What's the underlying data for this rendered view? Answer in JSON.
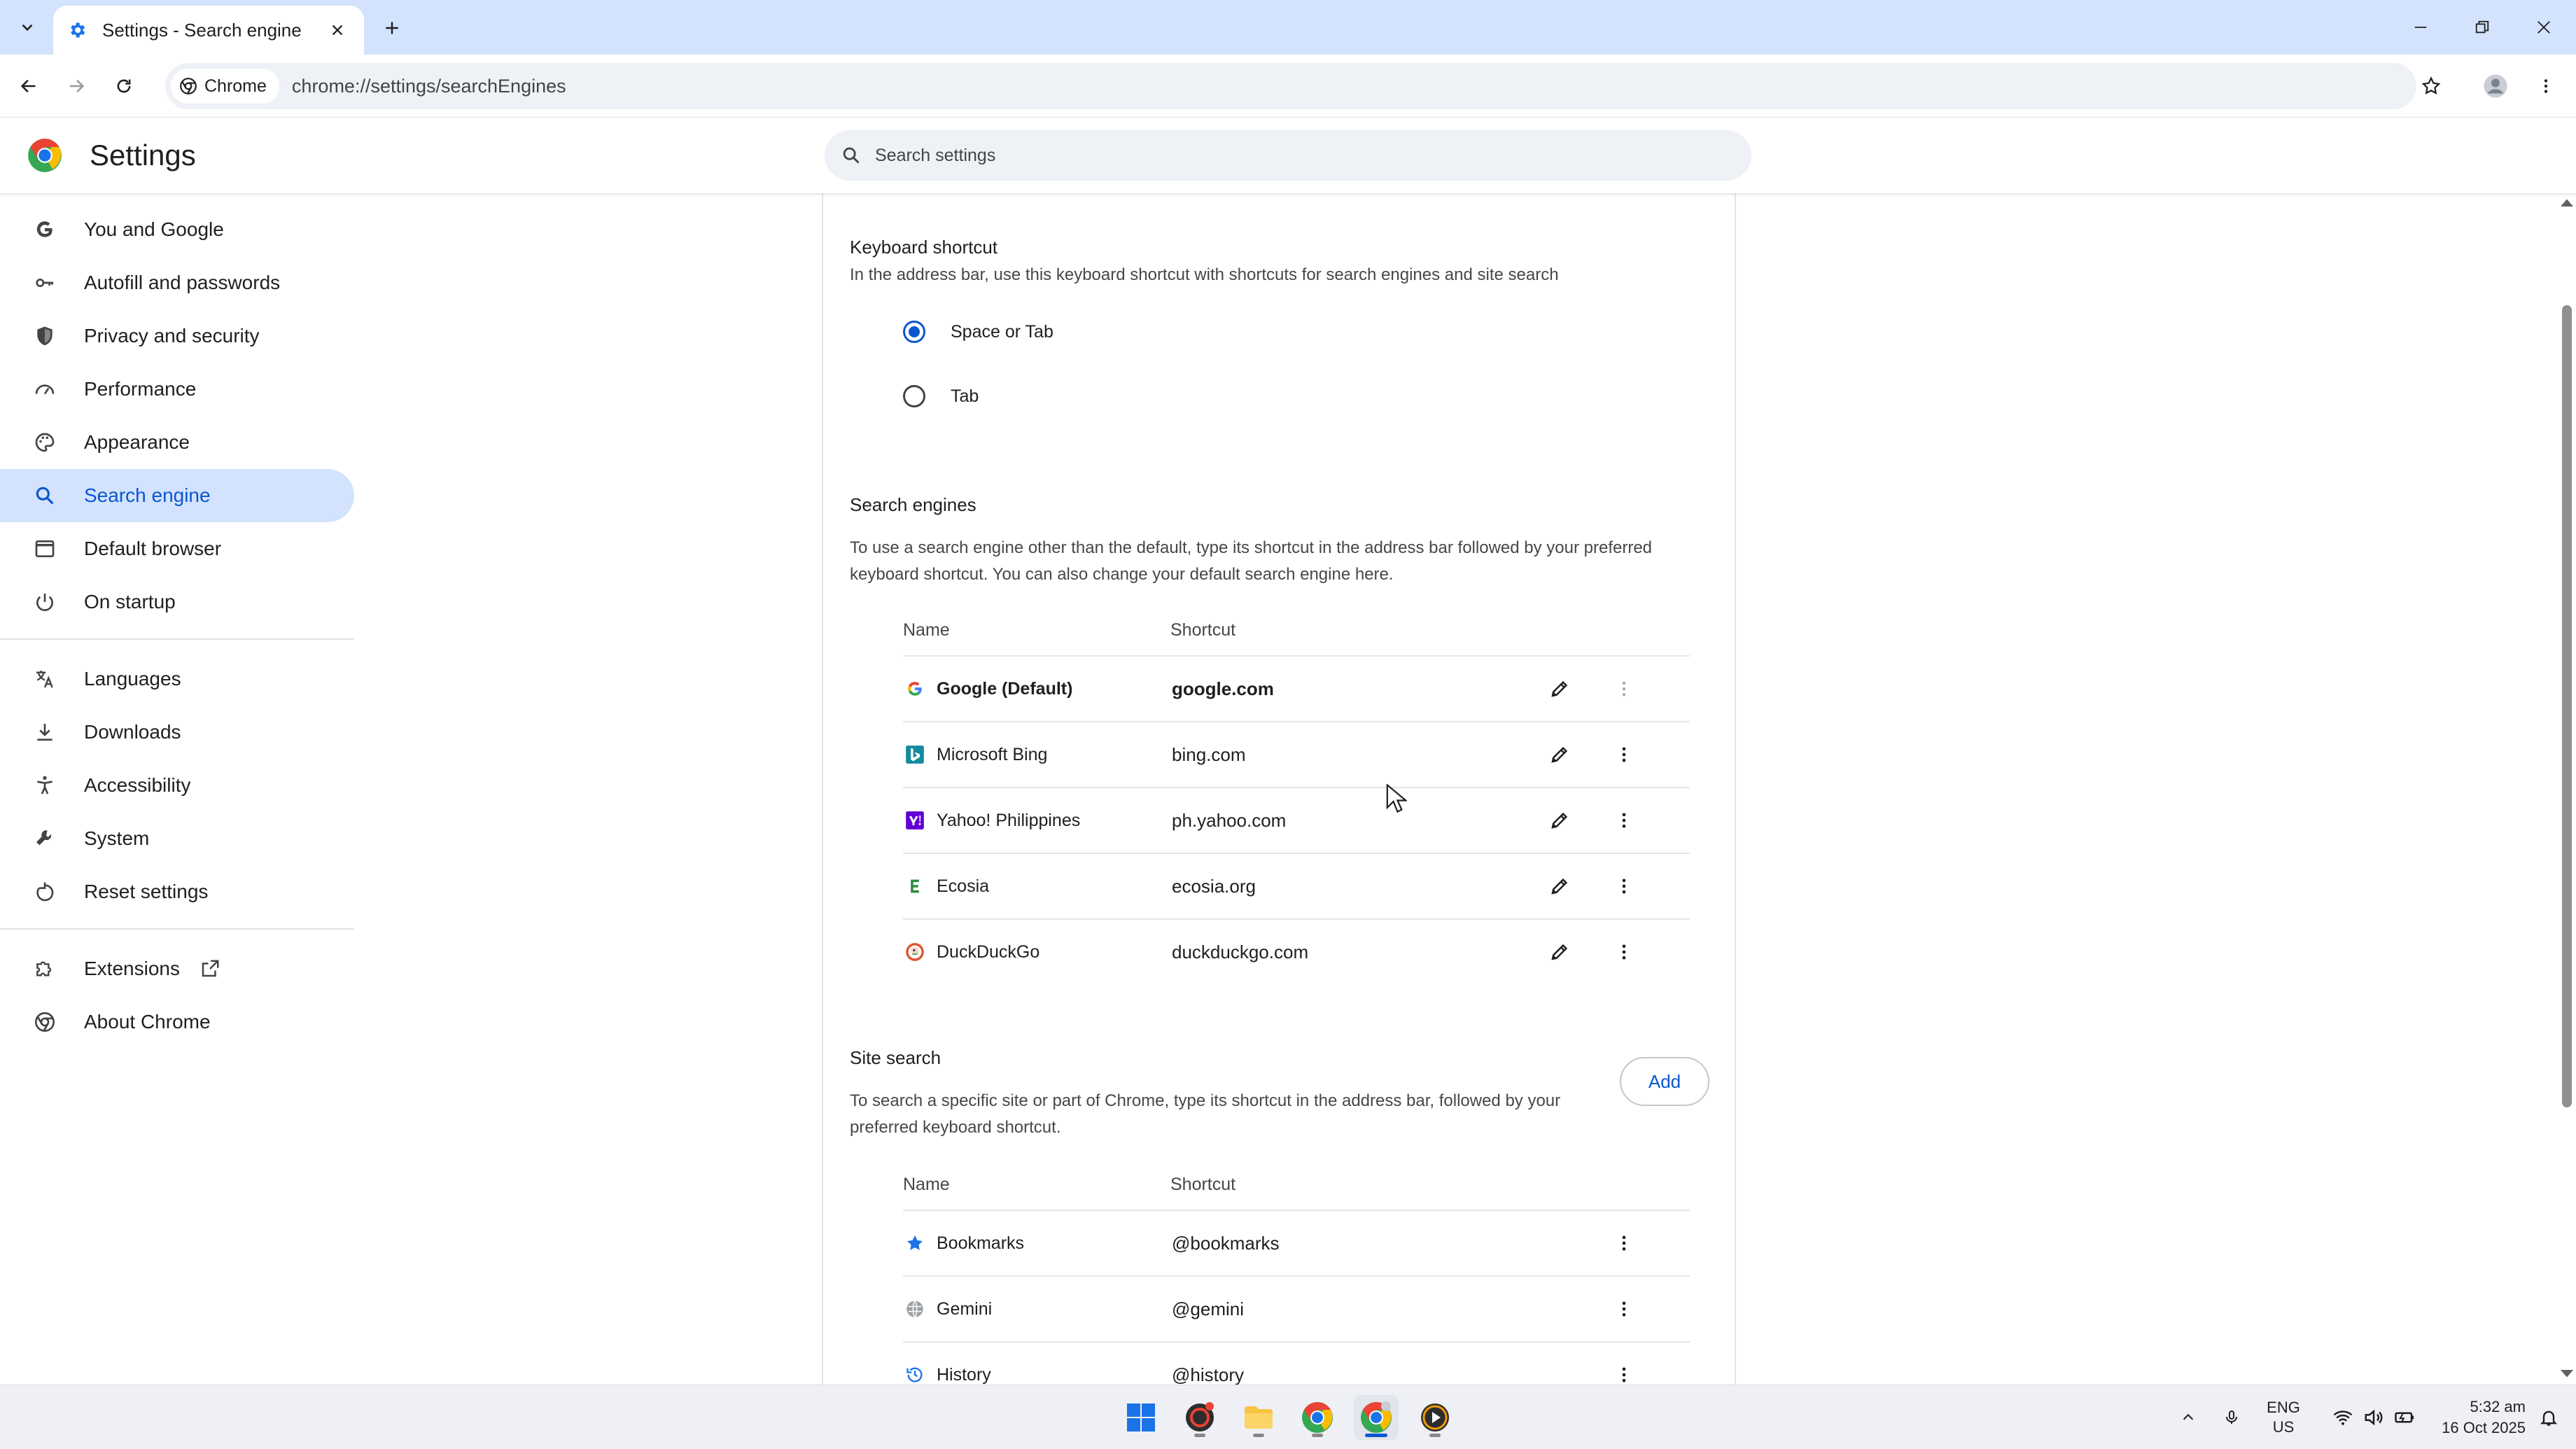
{
  "browser": {
    "tab_title": "Settings - Search engine",
    "chip_label": "Chrome",
    "url": "chrome://settings/searchEngines"
  },
  "header": {
    "title": "Settings",
    "search_placeholder": "Search settings"
  },
  "sidebar": {
    "items": [
      {
        "label": "You and Google",
        "icon": "google-g-icon"
      },
      {
        "label": "Autofill and passwords",
        "icon": "key-icon"
      },
      {
        "label": "Privacy and security",
        "icon": "shield-icon"
      },
      {
        "label": "Performance",
        "icon": "speedometer-icon"
      },
      {
        "label": "Appearance",
        "icon": "palette-icon"
      },
      {
        "label": "Search engine",
        "icon": "search-icon",
        "active": true
      },
      {
        "label": "Default browser",
        "icon": "browser-window-icon"
      },
      {
        "label": "On startup",
        "icon": "power-icon"
      },
      {
        "label": "Languages",
        "icon": "translate-icon"
      },
      {
        "label": "Downloads",
        "icon": "download-icon"
      },
      {
        "label": "Accessibility",
        "icon": "accessibility-icon"
      },
      {
        "label": "System",
        "icon": "wrench-icon"
      },
      {
        "label": "Reset settings",
        "icon": "reset-icon"
      },
      {
        "label": "Extensions",
        "icon": "puzzle-icon"
      },
      {
        "label": "About Chrome",
        "icon": "chrome-icon"
      }
    ]
  },
  "keyboard_shortcut": {
    "title": "Keyboard shortcut",
    "description": "In the address bar, use this keyboard shortcut with shortcuts for search engines and site search",
    "options": [
      {
        "label": "Space or Tab",
        "selected": true
      },
      {
        "label": "Tab",
        "selected": false
      }
    ]
  },
  "search_engines": {
    "title": "Search engines",
    "description_line1": "To use a search engine other than the default, type its shortcut in the address bar followed by your preferred",
    "description_line2": "keyboard shortcut. You can also change your default search engine here.",
    "col_name": "Name",
    "col_shortcut": "Shortcut",
    "rows": [
      {
        "name": "Google (Default)",
        "shortcut": "google.com",
        "icon": "google-favicon"
      },
      {
        "name": "Microsoft Bing",
        "shortcut": "bing.com",
        "icon": "bing-favicon"
      },
      {
        "name": "Yahoo! Philippines",
        "shortcut": "ph.yahoo.com",
        "icon": "yahoo-favicon"
      },
      {
        "name": "Ecosia",
        "shortcut": "ecosia.org",
        "icon": "ecosia-favicon"
      },
      {
        "name": "DuckDuckGo",
        "shortcut": "duckduckgo.com",
        "icon": "duckduckgo-favicon"
      }
    ]
  },
  "site_search": {
    "title": "Site search",
    "description_line1": "To search a specific site or part of Chrome, type its shortcut in the address bar, followed by your",
    "description_line2": "preferred keyboard shortcut.",
    "add_label": "Add",
    "col_name": "Name",
    "col_shortcut": "Shortcut",
    "rows": [
      {
        "name": "Bookmarks",
        "shortcut": "@bookmarks",
        "icon": "star-icon"
      },
      {
        "name": "Gemini",
        "shortcut": "@gemini",
        "icon": "globe-icon"
      },
      {
        "name": "History",
        "shortcut": "@history",
        "icon": "history-icon"
      }
    ]
  },
  "taskbar": {
    "lang_top": "ENG",
    "lang_bottom": "US",
    "time": "5:32 am",
    "date": "16 Oct 2025"
  },
  "colors": {
    "accent": "#0b57d0",
    "active_nav_bg": "#d3e3fd",
    "titlebar": "#d3e3fd"
  }
}
